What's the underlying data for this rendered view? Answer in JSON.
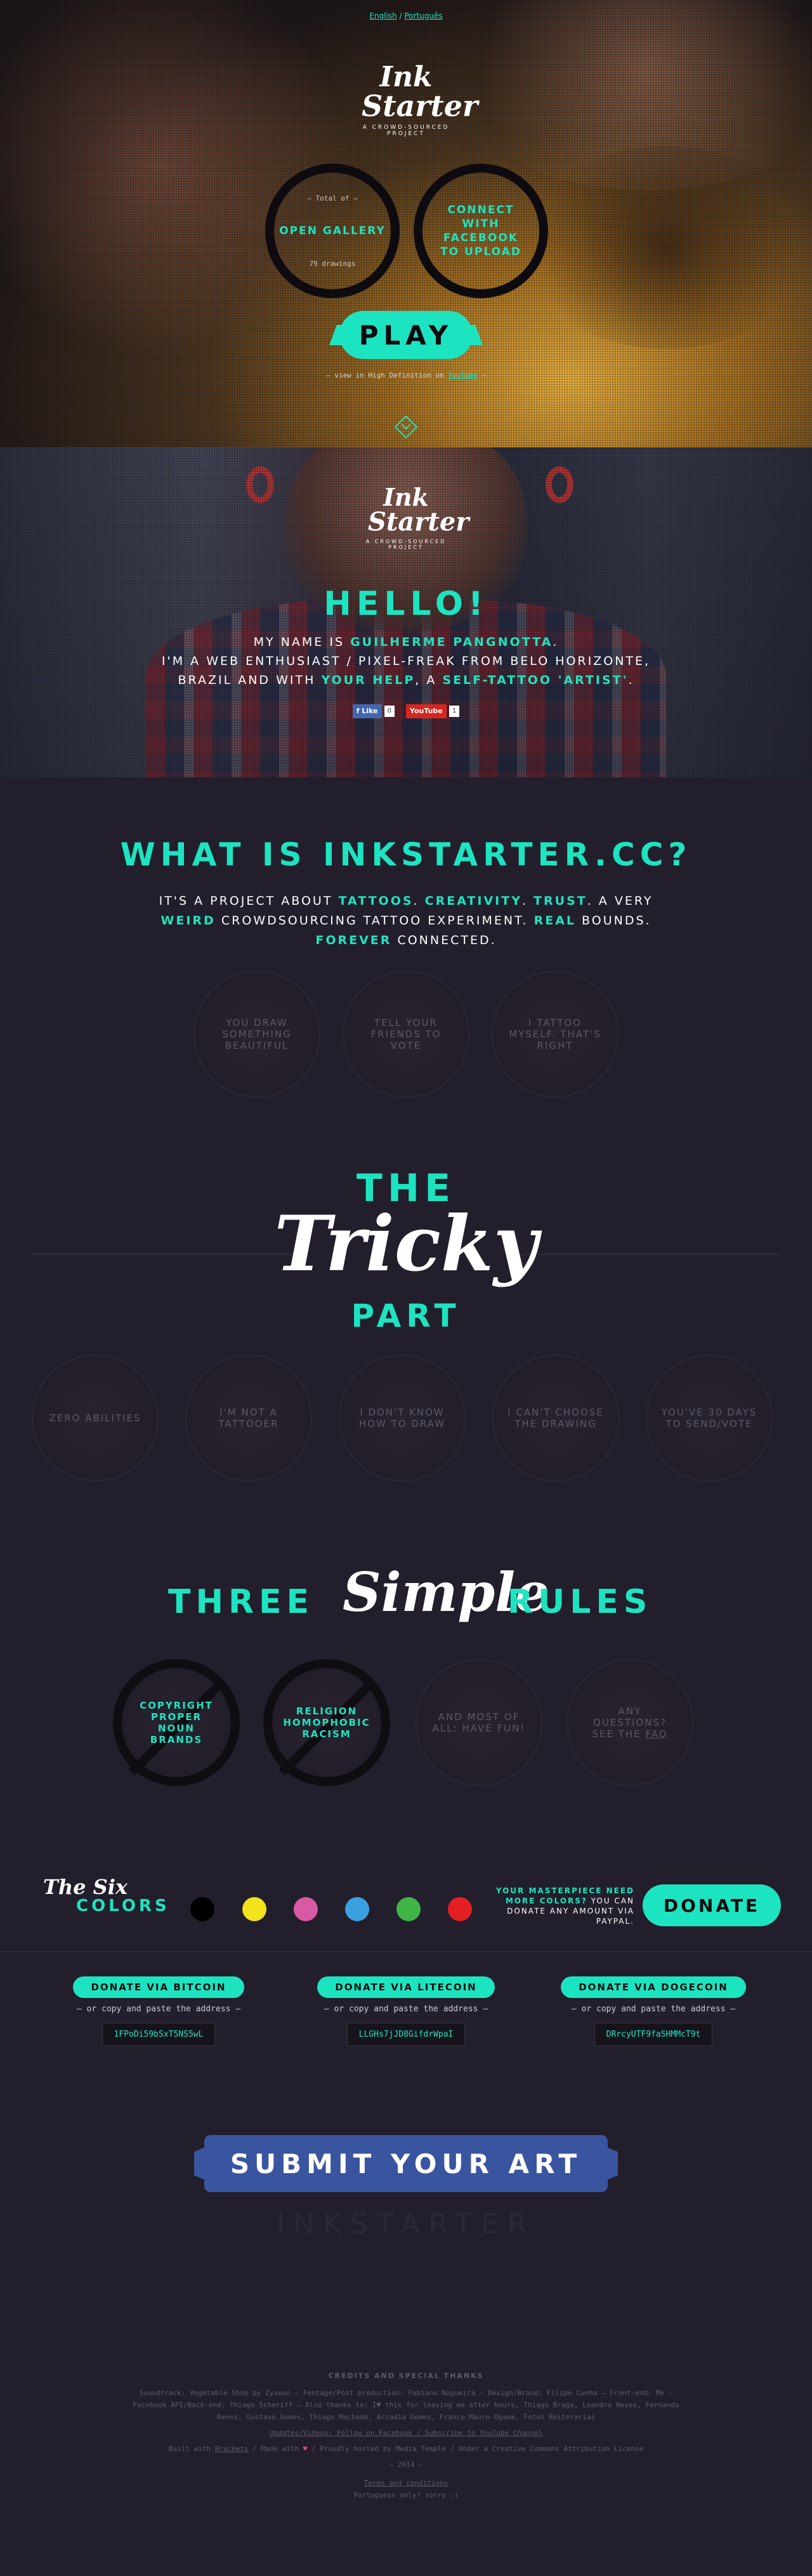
{
  "hero": {
    "lang_en": "English",
    "lang_sep": " / ",
    "lang_pt": "Português",
    "logo_line1": "Ink",
    "logo_line2": "Starter",
    "logo_tagline": "A CROWD-SOURCED PROJECT",
    "total_of": "— Total of —",
    "open_gallery": "OPEN GALLERY",
    "drawings_count": "79 drawings",
    "connect_facebook": "CONNECT WITH FACEBOOK TO UPLOAD",
    "play": "PLAY",
    "hd_text": "— view in High Definition on",
    "hd_link": "YouTube",
    "hd_end": "—"
  },
  "hello": {
    "logo_line1": "Ink",
    "logo_line2": "Starter",
    "logo_tagline": "A CROWD-SOURCED PROJECT",
    "title": "HELLO!",
    "line1_a": "MY NAME IS",
    "name": "GUILHERME PANGNOTTA",
    "line1_b": ".",
    "line2": "I'M A WEB ENTHUSIAST / PIXEL-FREAK FROM BELO HORIZONTE,",
    "line3_a": "BRAZIL AND WITH",
    "your_help": "YOUR HELP",
    "line3_b": ", A",
    "self_tattoo": "SELF-TATTOO 'ARTIST'",
    "line3_c": ".",
    "fb_like": "f Like",
    "fb_count": "0",
    "youtube": "YouTube",
    "yt_count": "1"
  },
  "what": {
    "title": "WHAT IS INKSTARTER.CC?",
    "l1_a": "IT'S A PROJECT ABOUT",
    "tattoos": "TATTOOS",
    "creativity": "CREATIVITY",
    "trust": "TRUST",
    "l1_b": ". A VERY",
    "weird": "WEIRD",
    "l2_a": "CROWDSOURCING TATTOO EXPERIMENT.",
    "real": "REAL",
    "l2_b": "BOUNDS.",
    "forever": "FOREVER",
    "l3": "CONNECTED.",
    "steps": [
      "YOU DRAW SOMETHING BEAUTIFUL",
      "TELL YOUR FRIENDS TO VOTE",
      "I TATTOO MYSELF. THAT'S RIGHT"
    ]
  },
  "tricky": {
    "the": "THE",
    "tricky": "Tricky",
    "part": "PART",
    "items": [
      "ZERO ABILITIES",
      "I'M NOT A TATTOOER",
      "I DON'T KNOW HOW TO DRAW",
      "I CAN'T CHOOSE THE DRAWING",
      "YOU'VE 30 DAYS TO SEND/VOTE"
    ]
  },
  "rules": {
    "three": "THREE",
    "simple": "Simple",
    "rules": "RULES",
    "items": [
      "COPYRIGHT PROPER NOUN BRANDS",
      "RELIGION HOMOPHOBIC RACISM",
      "AND MOST OF ALL: HAVE FUN!",
      "ANY QUESTIONS? SEE THE"
    ],
    "faq": "FAQ"
  },
  "colors": {
    "six": "The Six",
    "colors_label": "COLORS",
    "swatches": [
      "#000000",
      "#f2e31b",
      "#d85aa5",
      "#3aa0e0",
      "#3fb447",
      "#e41f23"
    ],
    "more_a": "YOUR MASTERPIECE NEED MORE COLORS?",
    "more_b": "YOU CAN DONATE ANY AMOUNT VIA PAYPAL.",
    "donate": "DONATE"
  },
  "crypto": [
    {
      "label": "DONATE VIA BITCOIN",
      "note": "— or copy and paste the address —",
      "address": "1FPoDi59bSxT5NS5wL"
    },
    {
      "label": "DONATE VIA LITECOIN",
      "note": "— or copy and paste the address —",
      "address": "LLGHs7jJD8GifdrWpaI"
    },
    {
      "label": "DONATE VIA DOGECOIN",
      "note": "— or copy and paste the address —",
      "address": "DRrcyUTF9faSHMMcT9t"
    }
  ],
  "submit": "SUBMIT YOUR ART",
  "ghost": "INKSTARTER",
  "credits": {
    "title": "CREDITS AND SPECIAL THANKS",
    "row1": "Soundtrack: Vegetable Shop by Zyxwun — Footage/Post production: Fabiano Nogueira — Design/Brand: Filipe Cunha — Front-end: Me —",
    "row2": "Facebook API/Back-end: Thiago Scheriff — Also thanks to: I♥ this for leaving me after hours, Thiago Braga, Leandro Neves, Fernanda",
    "row3": "Reves, Gustavo Gomes, Thiago Machado, Arcadia Gomes, Franco Mauro Ogame, Fotos Reiterarias",
    "row4": "Updates/Videos: Follow on Facebook / Subscribe to YouTube Channel",
    "row5a": "Built with",
    "row5b": "Brackets",
    "row5c": "/ Made with",
    "row5d": "♥",
    "row5e": "/ Proudly hosted by Media Temple / Under a Creative Commons Attribution License",
    "year": "— 2014 —",
    "terms": "Terms and conditions",
    "portuguese": "Portuguese only? sorry :)"
  }
}
